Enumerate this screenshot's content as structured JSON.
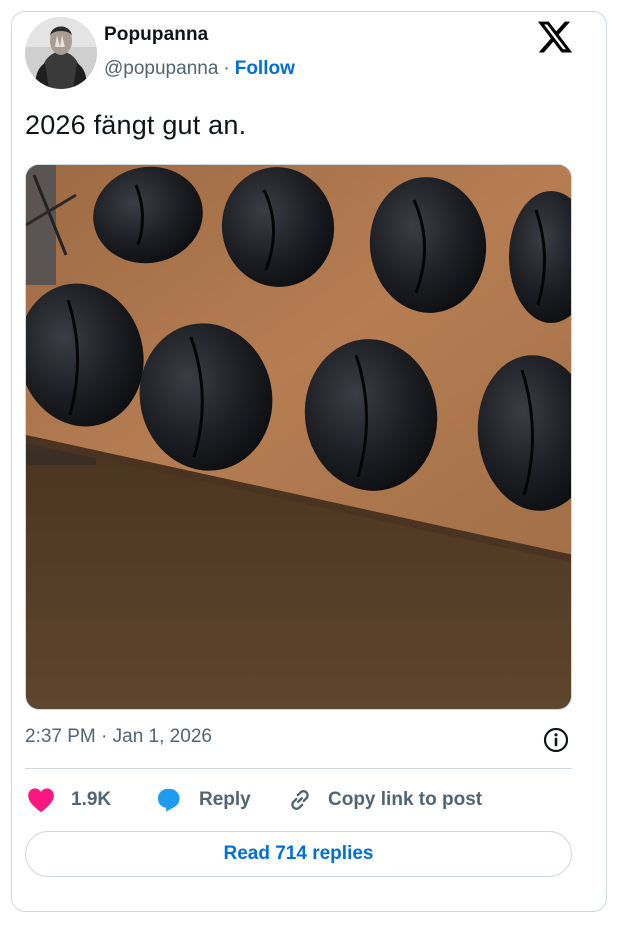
{
  "author": {
    "name": "Popupanna",
    "handle": "@popupanna",
    "separator": "·",
    "follow_label": "Follow"
  },
  "tweet": {
    "text": "2026 fängt gut an.",
    "timestamp": "2:37 PM · Jan 1, 2026"
  },
  "actions": {
    "likes": "1.9K",
    "reply_label": "Reply",
    "copy_label": "Copy link to post"
  },
  "read_replies_label": "Read 714 replies",
  "icons": {
    "logo": "x-logo-icon",
    "like": "heart-icon",
    "reply": "speech-bubble-icon",
    "copy": "link-icon",
    "info": "info-icon"
  },
  "colors": {
    "link": "#006fd6",
    "heart": "#f91880",
    "reply": "#1d9bf0",
    "muted": "#536471",
    "border": "#cfd9de"
  }
}
